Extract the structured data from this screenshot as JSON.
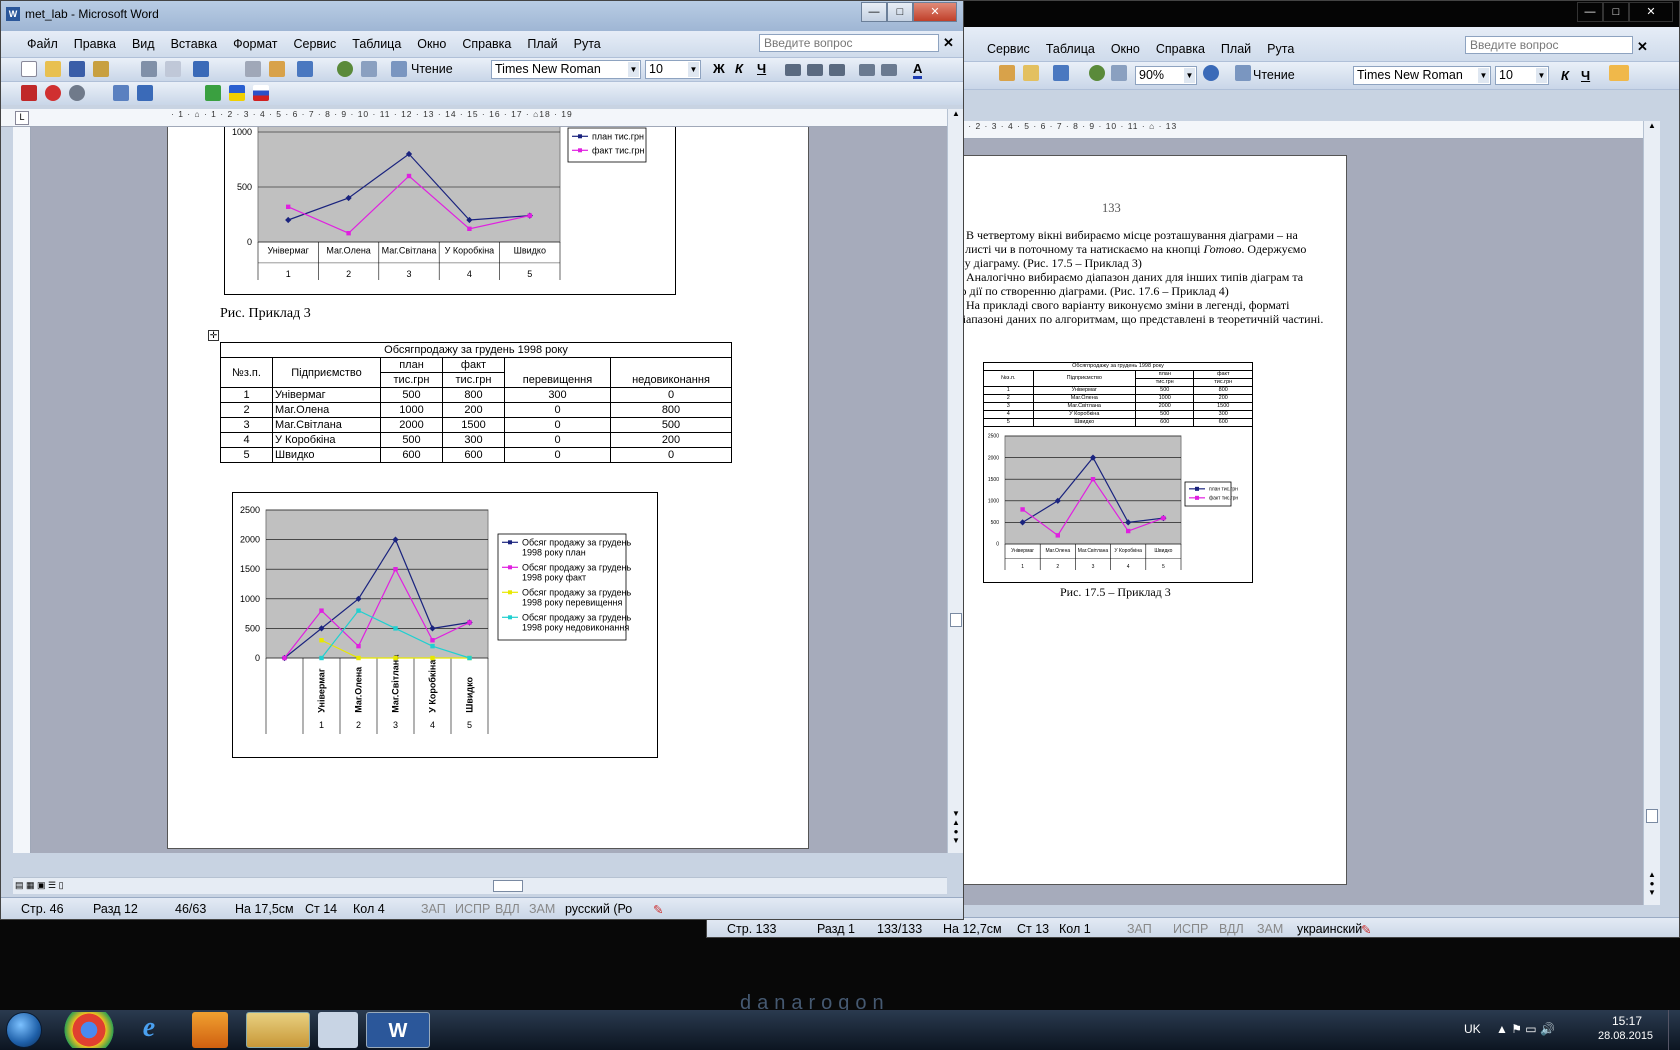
{
  "desktop": {
    "logo": "danarogon"
  },
  "left_window": {
    "title": "met_lab - Microsoft Word",
    "menu": [
      "Файл",
      "Правка",
      "Вид",
      "Вставка",
      "Формат",
      "Сервис",
      "Таблица",
      "Окно",
      "Справка",
      "Плай",
      "Рута"
    ],
    "help_placeholder": "Введите вопрос",
    "reading_label": "Чтение",
    "font": "Times New Roman",
    "size": "10",
    "bold": "Ж",
    "italic": "К",
    "underline": "Ч",
    "font_color": "A",
    "ruler": "· 1 · ⌂ · 1 · 2 · 3 · 4 · 5 · 6 · 7 · 8 · 9 · 10 · 11 · 12 · 13 · 14 · 15 · 16 · 17 · ⌂18 · 19",
    "caption_prev": "Рис. Приклад 3",
    "status": {
      "page": "Стр. 46",
      "section": "Разд 12",
      "pages": "46/63",
      "at": "На 17,5см",
      "line": "Ст 14",
      "col": "Кол 4",
      "rec": "ЗАП",
      "trk": "ИСПР",
      "ext": "ВДЛ",
      "ovr": "ЗАМ",
      "lang": "русский (Ро"
    }
  },
  "table": {
    "title": "Обсягпродажу за грудень 1998 року",
    "head_no": "№з.п.",
    "head_company": "Підприємство",
    "head_plan": "план",
    "head_fact": "факт",
    "head_plan_unit": "тис.грн",
    "head_fact_unit": "тис.грн",
    "head_over": "перевищення",
    "head_under": "недовиконання",
    "rows": [
      {
        "n": "1",
        "name": "Універмаг",
        "plan": "500",
        "fact": "800",
        "over": "300",
        "under": "0"
      },
      {
        "n": "2",
        "name": "Маг.Олена",
        "plan": "1000",
        "fact": "200",
        "over": "0",
        "under": "800"
      },
      {
        "n": "3",
        "name": "Маг.Світлана",
        "plan": "2000",
        "fact": "1500",
        "over": "0",
        "under": "500"
      },
      {
        "n": "4",
        "name": "У Коробкіна",
        "plan": "500",
        "fact": "300",
        "over": "0",
        "under": "200"
      },
      {
        "n": "5",
        "name": "Швидко",
        "plan": "600",
        "fact": "600",
        "over": "0",
        "under": "0"
      }
    ]
  },
  "right_window": {
    "menu": [
      "Сервис",
      "Таблица",
      "Окно",
      "Справка",
      "Плай",
      "Рута"
    ],
    "help_placeholder": "Введите вопрос",
    "zoom": "90%",
    "reading_label": "Чтение",
    "font": "Times New Roman",
    "size": "10",
    "italic": "К",
    "underline": "Ч",
    "ruler": "· 1 · ⌂ · 1 · 2 · 3 · 4 · 5 · 6 · 7 · 8 · 9 · 10 · 11 · ⌂ · 13",
    "page_number": "133",
    "p6_before": "6. В четвертому вікні вибираємо місце розташування діаграми – на окремому листі чи в поточному та натискаємо на кнопці ",
    "p6_italic": "Готово",
    "p6_after": ". Одержуємо побудовану діаграму. (Рис. 17.5 – Приклад 3)",
    "p7": "7. Аналогічно вибираємо діапазон даних для інших типів діаграм та виконуємо дії по створенню діаграми. (Рис. 17.6 – Приклад 4)",
    "p8": "8. На прикладі свого варіанту виконуємо зміни в легенді, форматі діаграм, діапазоні даних по алгоритмам, що представлені в теоретичній частині.",
    "caption": "Рис. 17.5 – Приклад 3",
    "status": {
      "page": "Стр. 133",
      "section": "Разд 1",
      "pages": "133/133",
      "at": "На 12,7см",
      "line": "Ст 13",
      "col": "Кол 1",
      "rec": "ЗАП",
      "trk": "ИСПР",
      "ext": "ВДЛ",
      "ovr": "ЗАМ",
      "lang": "украинский"
    }
  },
  "taskbar": {
    "lang": "UK",
    "time": "15:17",
    "date": "28.08.2015"
  },
  "chart_data": [
    {
      "type": "line",
      "categories": [
        "Універмаг",
        "Маг.Олена",
        "Маг.Світлана",
        "У Коробкіна",
        "Швидко"
      ],
      "category_numbers": [
        "1",
        "2",
        "3",
        "4",
        "5"
      ],
      "series": [
        {
          "name": "план тис.грн",
          "values": [
            500,
            1000,
            2000,
            500,
            600
          ],
          "color": "#1a237e"
        },
        {
          "name": "факт тис.грн",
          "values": [
            800,
            200,
            1500,
            300,
            600
          ],
          "color": "#e020e0"
        }
      ],
      "yticks": [
        "0",
        "500",
        "1000"
      ],
      "ylim": [
        0,
        2500
      ],
      "legend": "top-right"
    },
    {
      "type": "line",
      "categories": [
        "",
        "Універмаг",
        "Маг.Олена",
        "Маг.Світлана",
        "У Коробкіна",
        "Швидко"
      ],
      "category_numbers": [
        "",
        "1",
        "2",
        "3",
        "4",
        "5"
      ],
      "series": [
        {
          "name": "Обсяг продажу за грудень 1998 року план",
          "values": [
            0,
            500,
            1000,
            2000,
            500,
            600
          ],
          "color": "#1a237e"
        },
        {
          "name": "Обсяг продажу за грудень 1998 року факт",
          "values": [
            0,
            800,
            200,
            1500,
            300,
            600
          ],
          "color": "#e020e0"
        },
        {
          "name": "Обсяг продажу за грудень 1998 року перевищення",
          "values": [
            null,
            300,
            0,
            0,
            0,
            0
          ],
          "color": "#e8e800"
        },
        {
          "name": "Обсяг продажу за грудень 1998 року недовиконання",
          "values": [
            null,
            0,
            800,
            500,
            200,
            0
          ],
          "color": "#20d0d0"
        }
      ],
      "yticks": [
        "0",
        "500",
        "1000",
        "1500",
        "2000",
        "2500"
      ],
      "ylim": [
        0,
        2500
      ],
      "legend": "right"
    },
    {
      "type": "line",
      "categories": [
        "Універмаг",
        "Маг.Олена",
        "Маг.Світлана",
        "У Коробкіна",
        "Швидко"
      ],
      "category_numbers": [
        "1",
        "2",
        "3",
        "4",
        "5"
      ],
      "series": [
        {
          "name": "план тис.грн",
          "values": [
            500,
            1000,
            2000,
            500,
            600
          ],
          "color": "#1a237e"
        },
        {
          "name": "факт тис.грн",
          "values": [
            800,
            200,
            1500,
            300,
            600
          ],
          "color": "#e020e0"
        }
      ],
      "yticks": [
        "0",
        "500",
        "1000",
        "1500",
        "2000",
        "2500"
      ],
      "ylim": [
        0,
        2500
      ],
      "legend": "right"
    }
  ]
}
